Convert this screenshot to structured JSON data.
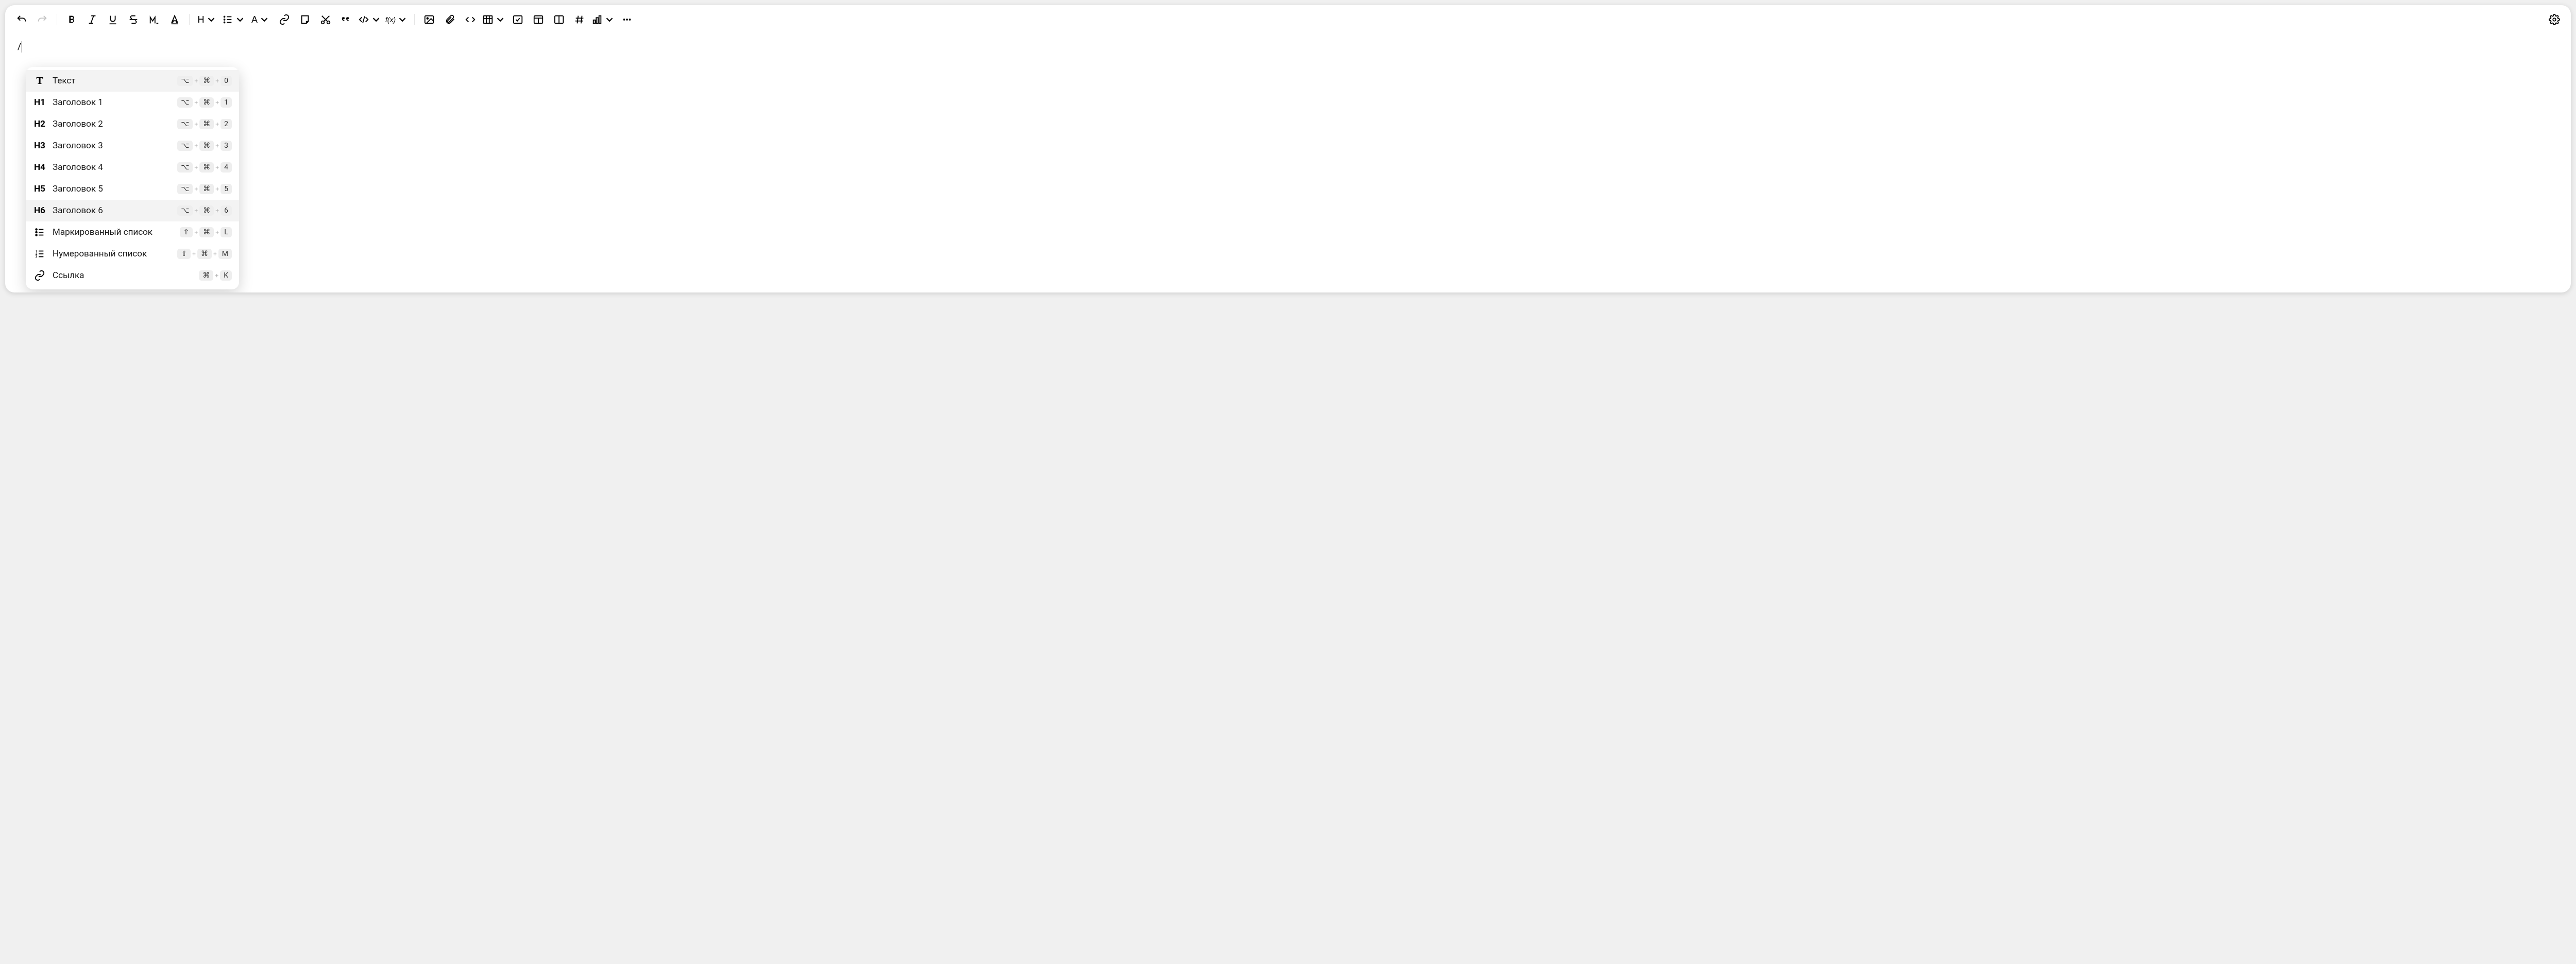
{
  "editor": {
    "content": "/"
  },
  "toolbar": {
    "undo": "Undo",
    "redo": "Redo",
    "bold": "B",
    "italic": "I",
    "underline": "U",
    "strike": "S",
    "mono": "M",
    "mark": "A",
    "heading": "H",
    "list": "List",
    "color": "A",
    "link": "Link",
    "note": "Note",
    "cut": "Cut",
    "quote": "Quote",
    "code": "Code",
    "fx": "f(x)",
    "image": "Image",
    "attach": "Attach",
    "embed": "Embed",
    "table": "Table",
    "checkbox": "Checkbox",
    "layout": "Layout",
    "columns": "Columns",
    "hash": "Anchor",
    "chart": "Chart",
    "more": "More",
    "settings": "Settings"
  },
  "menu": {
    "items": [
      {
        "icon": "T",
        "label": "Текст",
        "shortcut": [
          "⌥",
          "⌘",
          "0"
        ],
        "highlighted": true
      },
      {
        "icon": "H1",
        "label": "Заголовок 1",
        "shortcut": [
          "⌥",
          "⌘",
          "1"
        ]
      },
      {
        "icon": "H2",
        "label": "Заголовок 2",
        "shortcut": [
          "⌥",
          "⌘",
          "2"
        ]
      },
      {
        "icon": "H3",
        "label": "Заголовок 3",
        "shortcut": [
          "⌥",
          "⌘",
          "3"
        ]
      },
      {
        "icon": "H4",
        "label": "Заголовок 4",
        "shortcut": [
          "⌥",
          "⌘",
          "4"
        ]
      },
      {
        "icon": "H5",
        "label": "Заголовок 5",
        "shortcut": [
          "⌥",
          "⌘",
          "5"
        ]
      },
      {
        "icon": "H6",
        "label": "Заголовок 6",
        "shortcut": [
          "⌥",
          "⌘",
          "6"
        ],
        "highlighted": true
      },
      {
        "icon": "ul",
        "label": "Маркированный список",
        "shortcut": [
          "⇧",
          "⌘",
          "L"
        ]
      },
      {
        "icon": "ol",
        "label": "Нумерованный список",
        "shortcut": [
          "⇧",
          "⌘",
          "M"
        ]
      },
      {
        "icon": "link",
        "label": "Ссылка",
        "shortcut": [
          "⌘",
          "K"
        ]
      }
    ]
  }
}
